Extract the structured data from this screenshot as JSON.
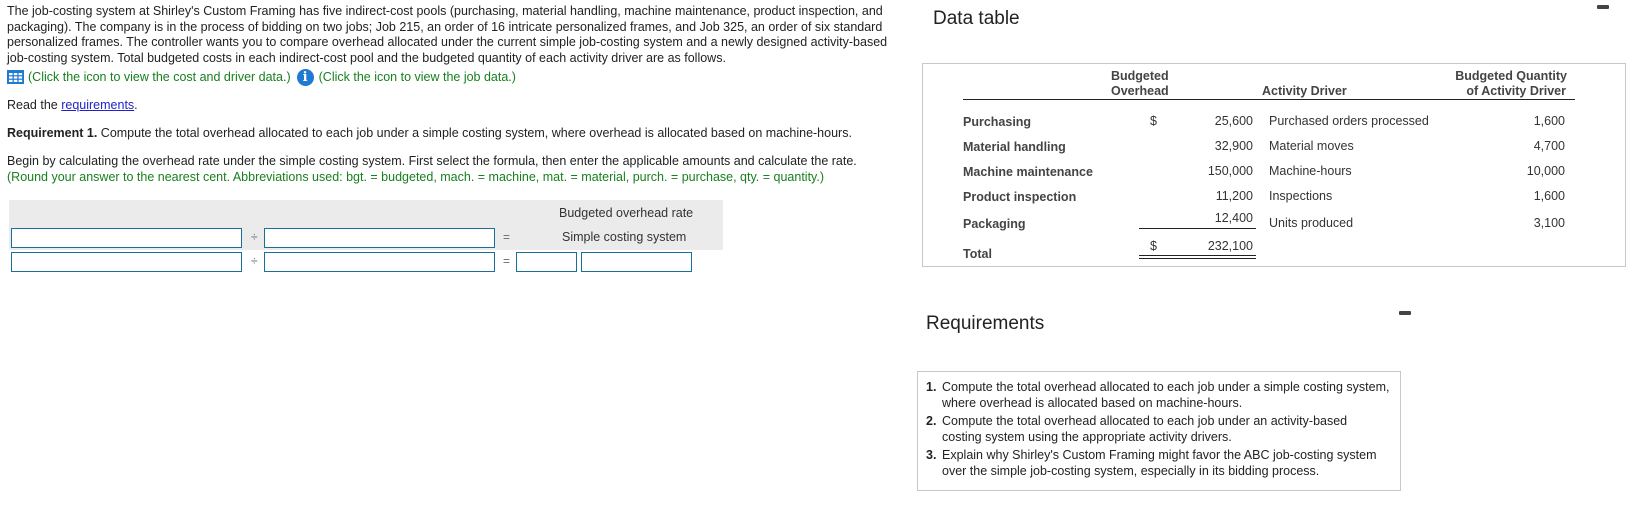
{
  "problem": {
    "intro": "The job-costing system at Shirley's Custom Framing has five indirect-cost pools (purchasing, material handling, machine maintenance, product inspection, and packaging). The company is in the process of bidding on two jobs; Job 215, an order of 16 intricate personalized frames, and Job 325, an order of six standard personalized frames. The controller wants you to compare overhead allocated under the current simple job-costing system and a newly designed activity-based job-costing system. Total budgeted costs in each indirect-cost pool and the budgeted quantity of each activity driver are as follows.",
    "cost_driver_link": "(Click the icon to view the cost and driver data.)",
    "job_data_link": "(Click the icon to view the job data.)",
    "read_prefix": "Read the ",
    "read_link": "requirements",
    "read_suffix": ".",
    "req1_label": "Requirement 1.",
    "req1_text": " Compute the total overhead allocated to each job under a simple costing system, where overhead is allocated based on machine-hours.",
    "begin_text": "Begin by calculating the overhead rate under the simple costing system. First select the formula, then enter the applicable amounts and calculate the rate.",
    "begin_note": "(Round your answer to the nearest cent. Abbreviations used: bgt. = budgeted, mach. = machine, mat. = material, purch. = purchase, qty. = quantity.)"
  },
  "formula": {
    "header": "Budgeted overhead rate",
    "row1_result_label": "Simple costing system",
    "divide_symbol": "÷",
    "equals_symbol": "=",
    "inputs": {
      "r1_numerator": "",
      "r1_denominator": "",
      "r2_numerator": "",
      "r2_denominator": "",
      "r2_result_a": "",
      "r2_result_b": ""
    }
  },
  "data_table": {
    "title": "Data table",
    "headers": {
      "overhead": [
        "Budgeted",
        "Overhead"
      ],
      "driver": "Activity Driver",
      "quantity": [
        "Budgeted Quantity",
        "of Activity Driver"
      ]
    },
    "currency": "$",
    "rows": [
      {
        "pool": "Purchasing",
        "overhead": "25,600",
        "driver": "Purchased orders processed",
        "quantity": "1,600",
        "show_currency": true
      },
      {
        "pool": "Material handling",
        "overhead": "32,900",
        "driver": "Material moves",
        "quantity": "4,700",
        "show_currency": false
      },
      {
        "pool": "Machine maintenance",
        "overhead": "150,000",
        "driver": "Machine-hours",
        "quantity": "10,000",
        "show_currency": false
      },
      {
        "pool": "Product inspection",
        "overhead": "11,200",
        "driver": "Inspections",
        "quantity": "1,600",
        "show_currency": false
      },
      {
        "pool": "Packaging",
        "overhead": "12,400",
        "driver": "Units produced",
        "quantity": "3,100",
        "show_currency": false
      }
    ],
    "total": {
      "label": "Total",
      "overhead": "232,100"
    }
  },
  "requirements": {
    "title": "Requirements",
    "items": [
      {
        "num": "1.",
        "text": "Compute the total overhead allocated to each job under a simple costing system, where overhead is allocated based on machine-hours."
      },
      {
        "num": "2.",
        "text": "Compute the total overhead allocated to each job under an activity-based costing system using the appropriate activity drivers."
      },
      {
        "num": "3.",
        "text": "Explain why Shirley's Custom Framing might favor the ABC job-costing system over the simple job-costing system, especially in its bidding process."
      }
    ]
  }
}
